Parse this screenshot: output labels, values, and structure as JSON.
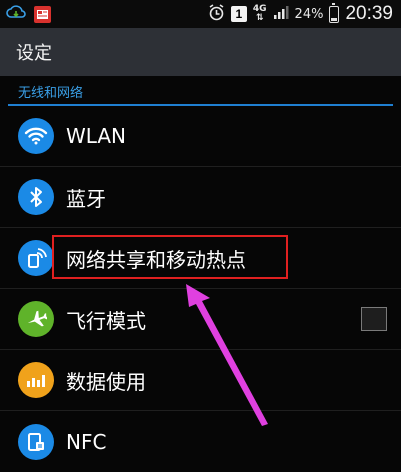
{
  "status_bar": {
    "network_type": "4G",
    "sim_slot": "1",
    "battery_percent": "24%",
    "battery_level": 0.24,
    "time": "20:39"
  },
  "header": {
    "title": "设定"
  },
  "section": {
    "title": "无线和网络"
  },
  "settings": [
    {
      "label": "WLAN",
      "icon": "wifi-icon",
      "color": "#1b8ae6"
    },
    {
      "label": "蓝牙",
      "icon": "bluetooth-icon",
      "color": "#1b8ae6"
    },
    {
      "label": "网络共享和移动热点",
      "icon": "tethering-icon",
      "color": "#1b8ae6"
    },
    {
      "label": "飞行模式",
      "icon": "airplane-icon",
      "color": "#5fb32a",
      "checked": false
    },
    {
      "label": "数据使用",
      "icon": "data-usage-icon",
      "color": "#f0a21b"
    },
    {
      "label": "NFC",
      "icon": "nfc-icon",
      "color": "#1b8ae6"
    }
  ],
  "colors": {
    "accent": "#1f7fd1",
    "highlight_box": "#e02020",
    "arrow": "#e040e0"
  }
}
